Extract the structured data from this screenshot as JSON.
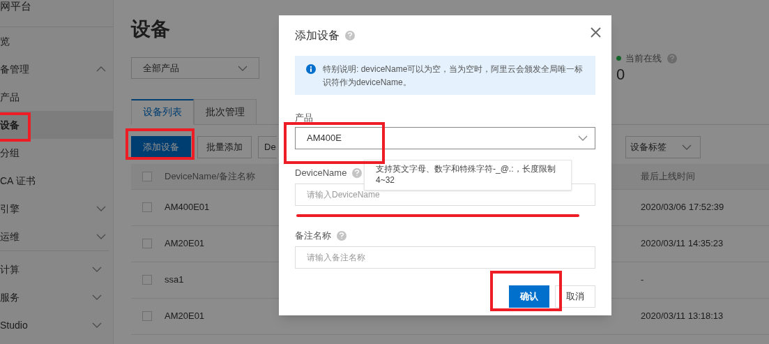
{
  "sidebar": {
    "brand": "网平台",
    "groups": [
      [
        {
          "label": "览"
        },
        {
          "label": "备管理",
          "expanded": true,
          "selected": false
        },
        {
          "label": "产品",
          "selected": false
        },
        {
          "label": "设备",
          "selected": true
        },
        {
          "label": "分组",
          "selected": false
        },
        {
          "label": "CA 证书",
          "selected": false
        },
        {
          "label": "引擎",
          "expanded": false,
          "selected": false
        },
        {
          "label": "运维",
          "expanded": false,
          "selected": false
        }
      ],
      [
        {
          "label": "计算",
          "expanded": false,
          "selected": false
        },
        {
          "label": "服务",
          "expanded": false,
          "selected": false
        },
        {
          "label": "Studio",
          "expanded": false,
          "selected": false
        }
      ]
    ]
  },
  "page": {
    "title": "设备",
    "product_filter": "全部产品",
    "online": {
      "label": "当前在线",
      "value": "0",
      "color": "#14652a"
    },
    "tabs": [
      {
        "label": "设备列表",
        "selected": true
      },
      {
        "label": "批次管理",
        "selected": false
      }
    ],
    "toolbar": {
      "primary": "添加设备",
      "secondary": "批量添加",
      "third": "De",
      "tag_filter": "设备标签"
    },
    "table": {
      "columns": [
        "DeviceName/备注名称",
        "最后上线时间"
      ],
      "header_checked": false,
      "rows": [
        {
          "name": "AM400E01",
          "last_online": "2020/03/06 17:52:39",
          "checked": false
        },
        {
          "name": "AM20E01",
          "last_online": "2020/03/11 14:35:23",
          "checked": false
        },
        {
          "name": "ssa1",
          "last_online": "-",
          "checked": false
        },
        {
          "name": "AM20E01",
          "last_online": "2020/03/11 13:18:13",
          "checked": false
        }
      ]
    }
  },
  "dialog": {
    "title": "添加设备",
    "notice": "特别说明: deviceName可以为空，当为空时，阿里云会颁发全局唯一标识符作为deviceName。",
    "product_label": "产品",
    "product_value": "AM400E",
    "device_name_label": "DeviceName",
    "device_name_placeholder": "请输入DeviceName",
    "tooltip": "支持英文字母、数字和特殊字符-_@.:，长度限制4~32",
    "remark_label": "备注名称",
    "remark_placeholder": "请输入备注名称",
    "buttons": [
      {
        "label": "确认",
        "kind": "primary"
      },
      {
        "label": "取消",
        "kind": "secondary"
      }
    ]
  }
}
